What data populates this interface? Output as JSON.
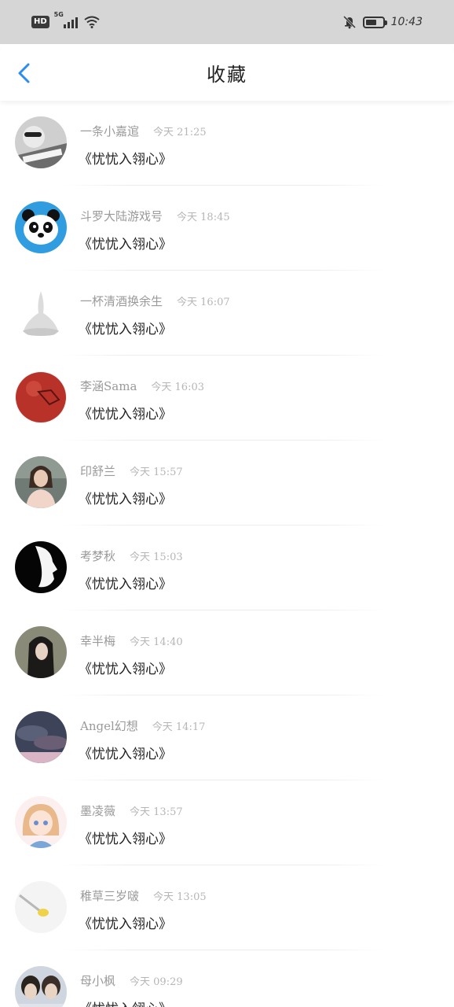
{
  "status_bar": {
    "hd": "HD",
    "network": "5G",
    "time": "10:43",
    "icons": [
      "signal-icon",
      "wifi-icon",
      "mute-bell-icon",
      "battery-icon"
    ]
  },
  "header": {
    "title": "收藏",
    "back_icon": "chevron-left-icon",
    "accent_color": "#2d8cf0"
  },
  "favorites": [
    {
      "name": "一条小嘉逭",
      "time": "今天 21:25",
      "message": "《忧忧入翎心》"
    },
    {
      "name": "斗罗大陆游戏号",
      "time": "今天 18:45",
      "message": "《忧忧入翎心》"
    },
    {
      "name": "一杯清酒换余生",
      "time": "今天 16:07",
      "message": "《忧忧入翎心》"
    },
    {
      "name": "李涵Sama",
      "time": "今天 16:03",
      "message": "《忧忧入翎心》"
    },
    {
      "name": "印舒兰",
      "time": "今天 15:57",
      "message": "《忧忧入翎心》"
    },
    {
      "name": "考梦秋",
      "time": "今天 15:03",
      "message": "《忧忧入翎心》"
    },
    {
      "name": "幸半梅",
      "time": "今天 14:40",
      "message": "《忧忧入翎心》"
    },
    {
      "name": "Angel幻想",
      "time": "今天 14:17",
      "message": "《忧忧入翎心》"
    },
    {
      "name": "墨凌薇",
      "time": "今天 13:57",
      "message": "《忧忧入翎心》"
    },
    {
      "name": "稚草三岁啵",
      "time": "今天 13:05",
      "message": "《忧忧入翎心》"
    },
    {
      "name": "母小枫",
      "time": "今天 09:29",
      "message": "《忧忧入翎心》"
    }
  ]
}
